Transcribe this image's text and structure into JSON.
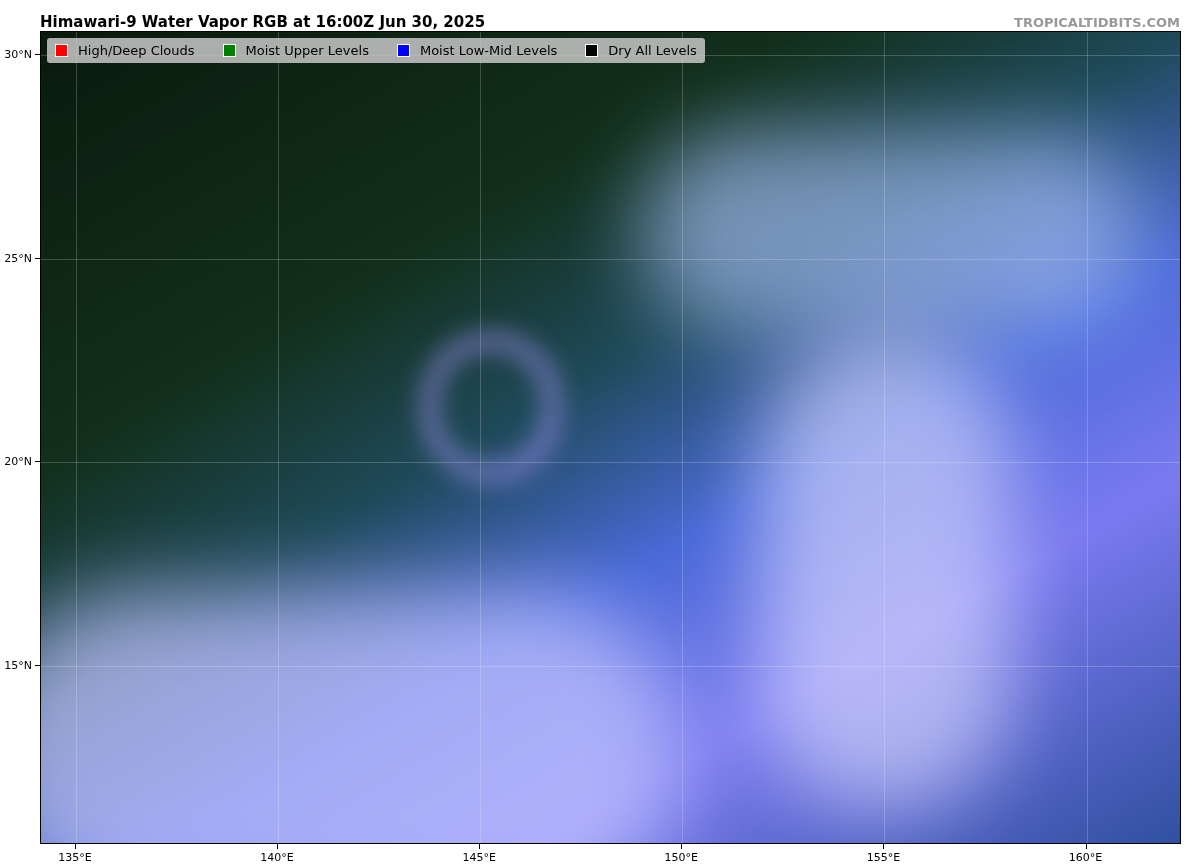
{
  "title": "Himawari-9 Water Vapor RGB at 16:00Z Jun 30, 2025",
  "source": "TROPICALTIDBITS.COM",
  "legend": [
    {
      "label": "High/Deep Clouds",
      "color": "#ff0000"
    },
    {
      "label": "Moist Upper Levels",
      "color": "#008000"
    },
    {
      "label": "Moist Low-Mid Levels",
      "color": "#0000ff"
    },
    {
      "label": "Dry All Levels",
      "color": "#000000"
    }
  ],
  "y_ticks": [
    "30°N",
    "25°N",
    "20°N",
    "15°N"
  ],
  "x_ticks": [
    "135°E",
    "140°E",
    "145°E",
    "150°E",
    "155°E",
    "160°E"
  ]
}
